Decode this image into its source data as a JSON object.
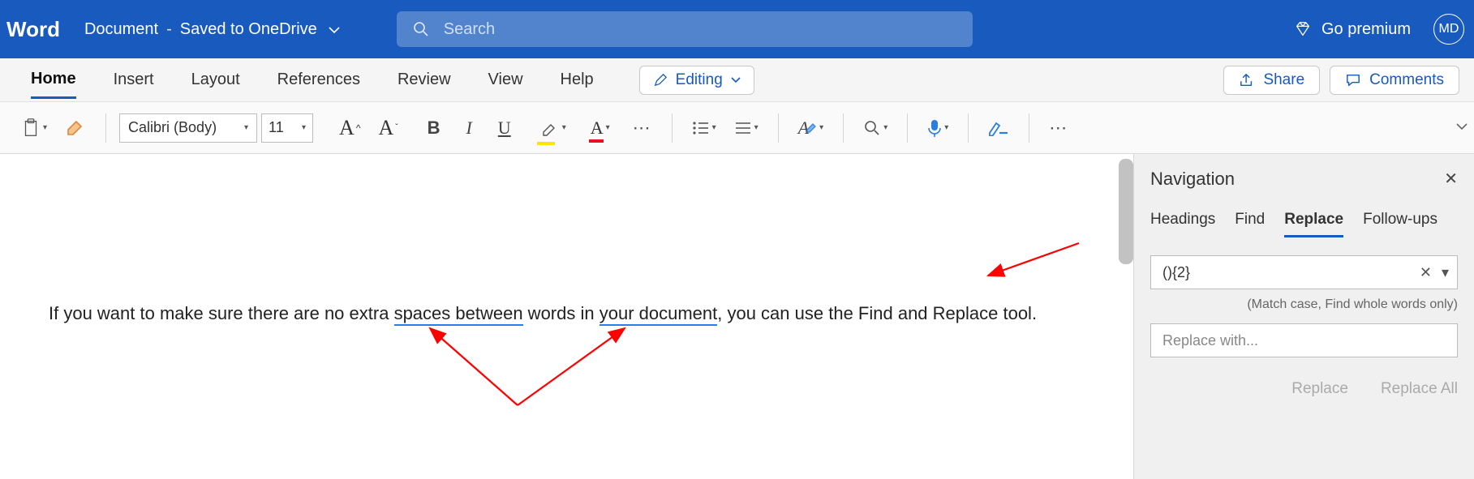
{
  "titlebar": {
    "app": "Word",
    "doc_name": "Document",
    "save_status": "Saved to OneDrive",
    "search_placeholder": "Search",
    "premium_label": "Go premium",
    "avatar_initials": "MD"
  },
  "tabs": {
    "items": [
      "Home",
      "Insert",
      "Layout",
      "References",
      "Review",
      "View",
      "Help"
    ],
    "active": "Home",
    "editing_label": "Editing",
    "share_label": "Share",
    "comments_label": "Comments"
  },
  "toolbar": {
    "font_name": "Calibri (Body)",
    "font_size": "11"
  },
  "document": {
    "t1": "If you want to make sure there are no extra ",
    "u1": "spaces  between",
    "t2": " words in ",
    "u2": "your  document",
    "t3": ", you can use the Find and Replace tool."
  },
  "nav": {
    "title": "Navigation",
    "tabs": [
      "Headings",
      "Find",
      "Replace",
      "Follow-ups"
    ],
    "active": "Replace",
    "find_value": "(){2}",
    "match_note": "(Match case, Find whole words only)",
    "replace_placeholder": "Replace with...",
    "replace_btn": "Replace",
    "replace_all_btn": "Replace All"
  }
}
